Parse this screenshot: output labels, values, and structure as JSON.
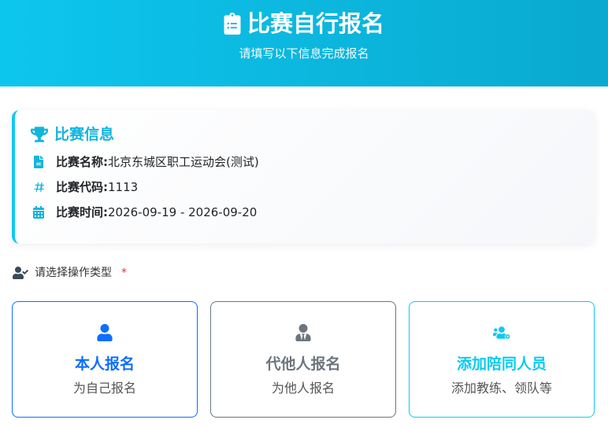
{
  "header": {
    "title": "比赛自行报名",
    "subtitle": "请填写以下信息完成报名"
  },
  "competition": {
    "section_title": "比赛信息",
    "name_label": "比赛名称:",
    "name_value": "北京东城区职工运动会(测试)",
    "code_label": "比赛代码:",
    "code_value": "1113",
    "time_label": "比赛时间:",
    "time_value": "2026-09-19 - 2026-09-20"
  },
  "operation": {
    "label": "请选择操作类型",
    "required_mark": "*",
    "options": [
      {
        "title": "本人报名",
        "desc": "为自己报名",
        "icon": "user-icon",
        "color": "#0d6efd"
      },
      {
        "title": "代他人报名",
        "desc": "为他人报名",
        "icon": "user-tie-icon",
        "color": "#6c757d"
      },
      {
        "title": "添加陪同人员",
        "desc": "添加教练、领队等",
        "icon": "users-cog-icon",
        "color": "#0dcaf0"
      }
    ]
  },
  "colors": {
    "header_gradient_start": "#0dc6ee",
    "header_gradient_end": "#0aa9cf",
    "accent": "#0dcaf0",
    "primary": "#0d6efd",
    "secondary": "#6c757d",
    "required": "#dc3545"
  }
}
